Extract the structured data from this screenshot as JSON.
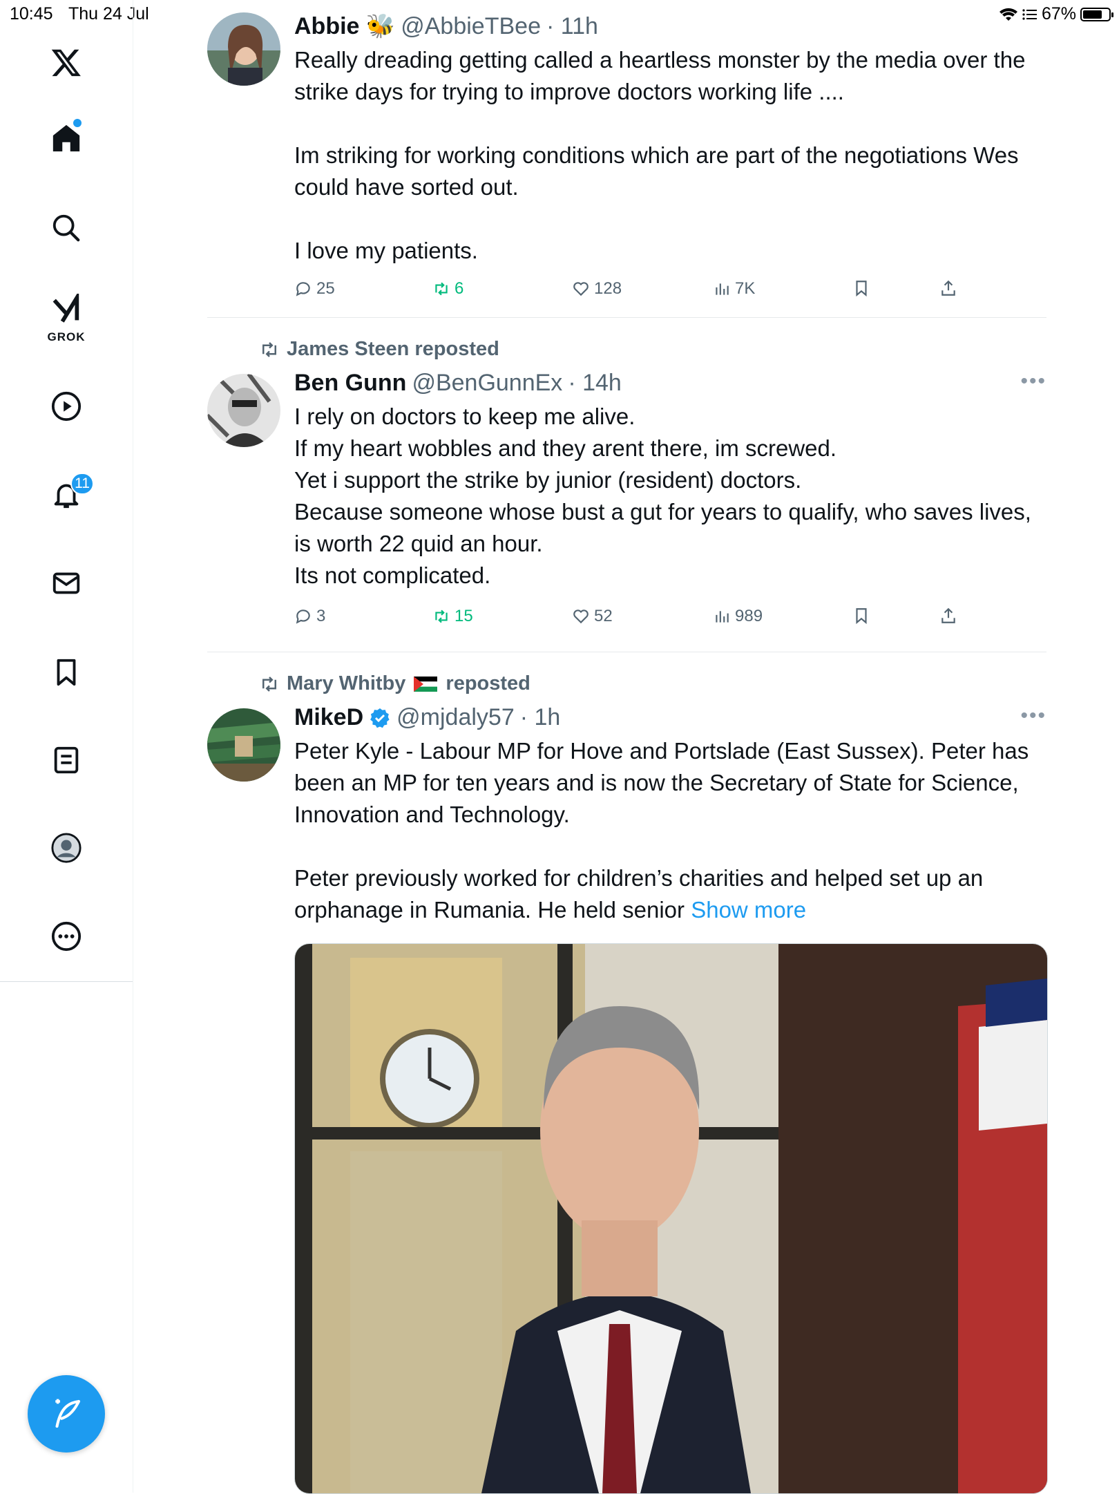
{
  "status": {
    "time": "10:45",
    "date": "Thu 24 Jul",
    "battery": "67%"
  },
  "nav": {
    "items": [
      "X",
      "Home",
      "Search",
      "Grok",
      "Video",
      "Notifications",
      "Messages",
      "Bookmarks",
      "Lists",
      "Profile",
      "More"
    ],
    "grok_label": "GROK",
    "notifications_badge": "11"
  },
  "tweets": [
    {
      "name": "Abbie 🐝",
      "handle": "@AbbieTBee",
      "time": "· 11h",
      "text": "Really dreading getting called a heartless monster by the media over the strike days for trying to improve doctors working life ....\n\nIm striking for working conditions which are part of the negotiations Wes could have sorted out.\n\nI love my patients.",
      "replies": "25",
      "reposts": "6",
      "likes": "128",
      "views": "7K"
    },
    {
      "reposted_by": "James Steen reposted",
      "name": "Ben Gunn",
      "handle": "@BenGunnEx",
      "time": "· 14h",
      "text": "I rely on doctors to keep me alive.\nIf my heart wobbles and they arent there, im screwed.\nYet i support the strike by junior (resident) doctors.\nBecause someone whose bust a gut for years to qualify, who saves lives, is worth 22 quid an hour.\nIts not complicated.",
      "replies": "3",
      "reposts": "15",
      "likes": "52",
      "views": "989"
    },
    {
      "reposted_by_name": "Mary Whitby",
      "reposted_suffix": "reposted",
      "name": "MikeD",
      "handle": "@mjdaly57",
      "time": "· 1h",
      "text": "Peter Kyle - Labour MP for Hove and Portslade (East Sussex). Peter has been an MP for ten years and is now the Secretary of State for Science, Innovation and Technology.\n\nPeter previously worked for children’s charities and helped set up an orphanage in Rumania. He held senior ",
      "show_more": "Show more"
    }
  ],
  "colors": {
    "accent": "#1d9bf0",
    "repost_green": "#00ba7c",
    "muted": "#536471"
  }
}
